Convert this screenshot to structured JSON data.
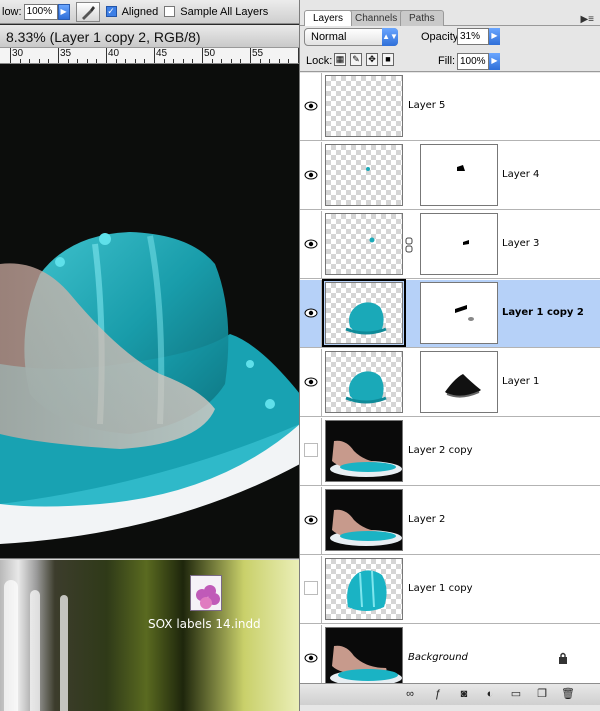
{
  "options_bar": {
    "flow_label": "low:",
    "flow_value": "100%",
    "aligned_label": "Aligned",
    "aligned_checked": true,
    "sample_all_label": "Sample All Layers",
    "sample_all_checked": false
  },
  "document": {
    "title": "8.33% (Layer 1 copy 2, RGB/8)",
    "ruler_numbers": [
      "30",
      "35",
      "40",
      "45",
      "50",
      "55"
    ]
  },
  "desktop": {
    "file_name": "SOX labels 14.indd"
  },
  "palette": {
    "tabs": [
      "Layers",
      "Channels",
      "Paths"
    ],
    "active_tab": "Layers",
    "blend_mode": "Normal",
    "opacity_label": "Opacity:",
    "opacity_value": "31%",
    "lock_label": "Lock:",
    "fill_label": "Fill:",
    "fill_value": "100%",
    "layers": [
      {
        "name": "Layer 5",
        "visible": true,
        "selected": false
      },
      {
        "name": "Layer 4",
        "visible": true,
        "selected": false
      },
      {
        "name": "Layer 3",
        "visible": true,
        "selected": false
      },
      {
        "name": "Layer 1 copy 2",
        "visible": true,
        "selected": true
      },
      {
        "name": "Layer 1",
        "visible": true,
        "selected": false
      },
      {
        "name": "Layer 2 copy",
        "visible": false,
        "selected": false
      },
      {
        "name": "Layer 2",
        "visible": true,
        "selected": false
      },
      {
        "name": "Layer 1 copy",
        "visible": false,
        "selected": false
      },
      {
        "name": "Background",
        "visible": true,
        "selected": false,
        "locked": true
      }
    ]
  },
  "colors": {
    "selection": "#b6d1f8",
    "accent_blue": "#2f6fd8",
    "jelly": "#1fb7c6"
  }
}
